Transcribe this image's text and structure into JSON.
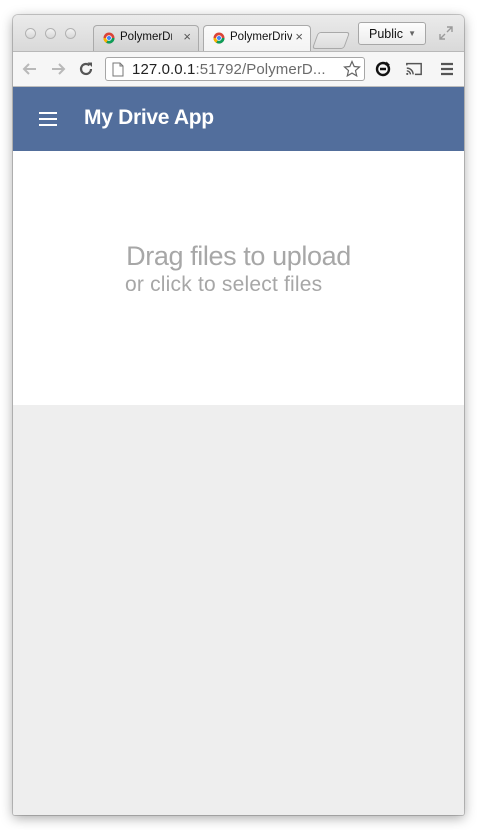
{
  "browser": {
    "tabs": [
      {
        "title": "PolymerDri",
        "close": "×",
        "favicon": "chrome-favicon"
      },
      {
        "title": "PolymerDrive",
        "close": "×",
        "favicon": "chrome-favicon"
      }
    ],
    "profile_label": "Public",
    "url_host": "127.0.0.1",
    "url_rest": ":51792/PolymerD..."
  },
  "app": {
    "title": "My Drive App",
    "menu_icon": "hamburger-menu-icon"
  },
  "dropzone": {
    "line1": "Drag files to upload",
    "line2": "or click to select files"
  },
  "colors": {
    "appbar": "#526e9c",
    "drop_text": "#a7a7a7",
    "content_bg": "#eeeeee"
  }
}
